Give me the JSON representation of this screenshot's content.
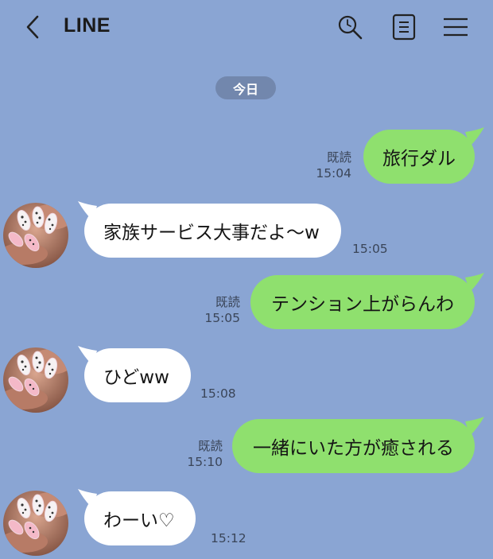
{
  "header": {
    "title": "LINE",
    "icons": [
      "back-icon",
      "search-icon",
      "notes-icon",
      "menu-icon"
    ]
  },
  "date_label": "今日",
  "colors": {
    "background": "#8aa5d3",
    "outgoing_bubble": "#8fe06e",
    "incoming_bubble": "#ffffff",
    "date_pill": "#7287ad"
  },
  "messages": [
    {
      "direction": "out",
      "text": "旅行ダル",
      "read": "既読",
      "time": "15:04"
    },
    {
      "direction": "in",
      "text": "家族サービス大事だよ〜w",
      "time": "15:05"
    },
    {
      "direction": "out",
      "text": "テンション上がらんわ",
      "read": "既読",
      "time": "15:05"
    },
    {
      "direction": "in",
      "text": "ひどww",
      "time": "15:08"
    },
    {
      "direction": "out",
      "text": "一緒にいた方が癒される",
      "read": "既読",
      "time": "15:10"
    },
    {
      "direction": "in",
      "text": "わーい♡",
      "time": "15:12"
    }
  ]
}
